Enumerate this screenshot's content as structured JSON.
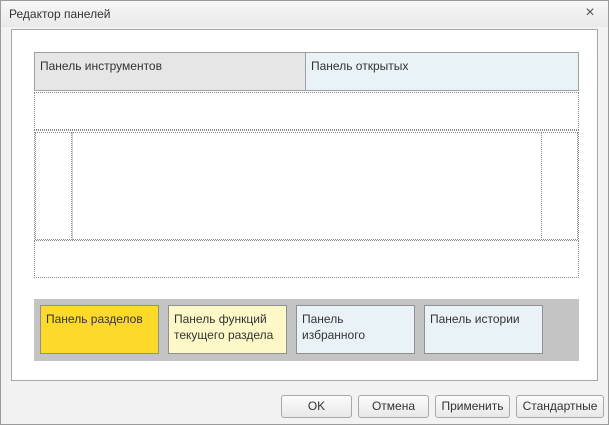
{
  "window": {
    "title": "Редактор панелей",
    "close_glyph": "×"
  },
  "layout": {
    "top_left_panel": "Панель инструментов",
    "top_right_panel": "Панель открытых"
  },
  "palette": {
    "items": [
      {
        "label": "Панель разделов",
        "color": "#fdd92a"
      },
      {
        "label": "Панель функций текущего раздела",
        "color": "#fdf8c8"
      },
      {
        "label": "Панель избранного",
        "color": "#e9f3f7"
      },
      {
        "label": "Панель истории",
        "color": "#e9f3f7"
      }
    ]
  },
  "buttons": {
    "ok": "OK",
    "cancel": "Отмена",
    "apply": "Применить",
    "default": "Стандартные"
  }
}
